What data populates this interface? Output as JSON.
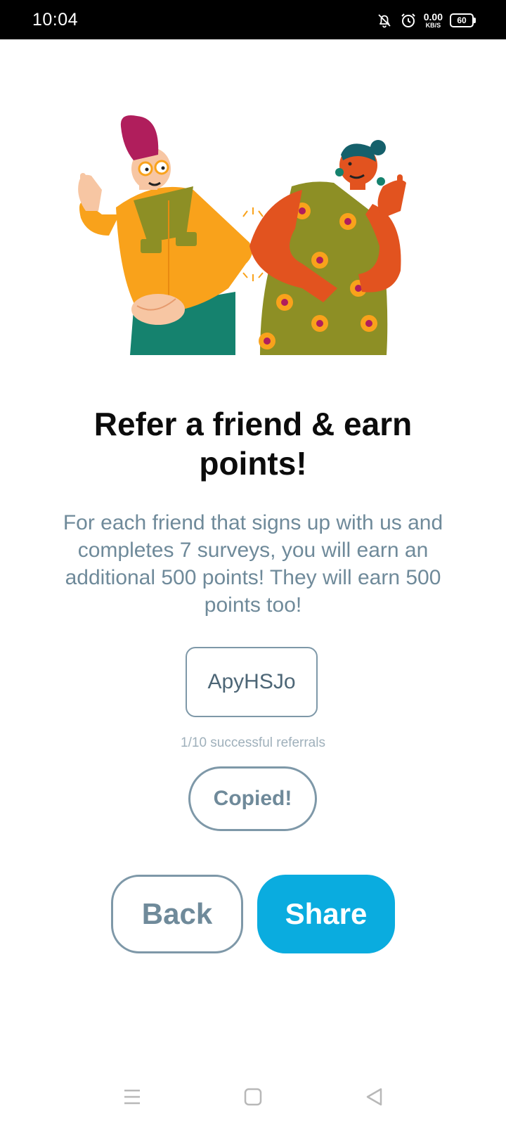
{
  "status_bar": {
    "time": "10:04",
    "net_speed_value": "0.00",
    "net_speed_unit": "KB/S",
    "battery_level": "60",
    "icons": [
      "bell-muted-icon",
      "alarm-icon",
      "battery-icon"
    ]
  },
  "illustration": {
    "name": "two-friends-thumbs-up-illustration",
    "colors": {
      "jacket": "#f9a21b",
      "dress": "#8d8f25",
      "skin_left": "#f7c6a3",
      "skin_right": "#e2531f",
      "hat": "#b01e5c",
      "pants": "#15826e"
    }
  },
  "content": {
    "title": "Refer a friend & earn points!",
    "description": "For each friend that signs up with us and completes 7 surveys, you will earn an additional 500 points! They will earn 500 points too!",
    "referral_code": "ApyHSJo",
    "referrals_status": "1/10 successful referrals",
    "copied_label": "Copied!"
  },
  "actions": {
    "back_label": "Back",
    "share_label": "Share"
  },
  "nav_bar": {
    "icons": [
      "menu-icon",
      "home-square-icon",
      "back-triangle-icon"
    ]
  },
  "colors": {
    "accent": "#0aacdf",
    "text_muted": "#6f8a9a",
    "border": "#7e98a8",
    "title": "#0c0c0c"
  }
}
